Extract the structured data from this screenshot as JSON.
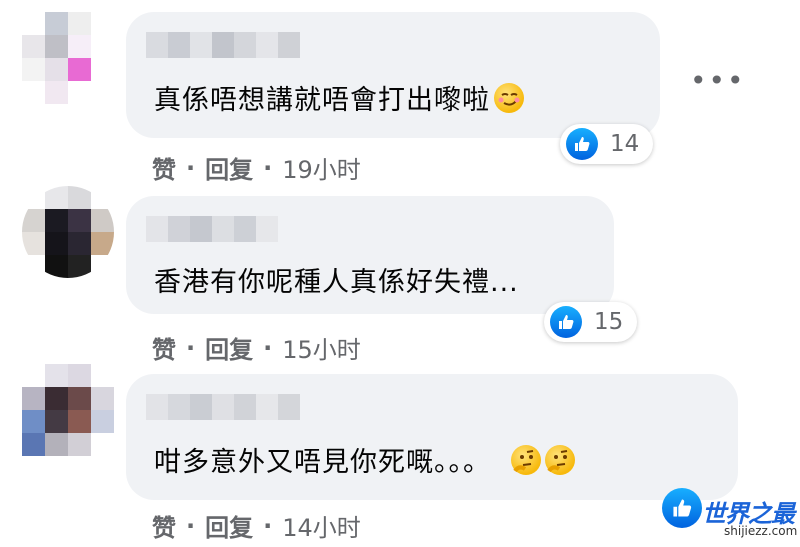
{
  "comments": [
    {
      "text": "真係唔想講就唔會打出嚟啦",
      "emoji_icons": [
        "smirking-face"
      ],
      "reaction_count": "14",
      "actions": {
        "like": "赞",
        "reply": "回复",
        "time": "19小时"
      }
    },
    {
      "text": "香港有你呢種人真係好失禮...",
      "emoji_icons": [],
      "reaction_count": "15",
      "actions": {
        "like": "赞",
        "reply": "回复",
        "time": "15小时"
      }
    },
    {
      "text": "咁多意外又唔見你死嘅。。。",
      "emoji_icons": [
        "thinking-face",
        "thinking-face"
      ],
      "reaction_count": "",
      "actions": {
        "like": "赞",
        "reply": "回复",
        "time": "14小时"
      }
    }
  ],
  "separator": "·",
  "more_icon": "•••",
  "watermark": {
    "title": "世界之最",
    "url": "shijiezz.com"
  },
  "colors": {
    "bubble": "#f0f2f5",
    "like_blue": "#0866ff",
    "meta_gray": "#65676b"
  }
}
